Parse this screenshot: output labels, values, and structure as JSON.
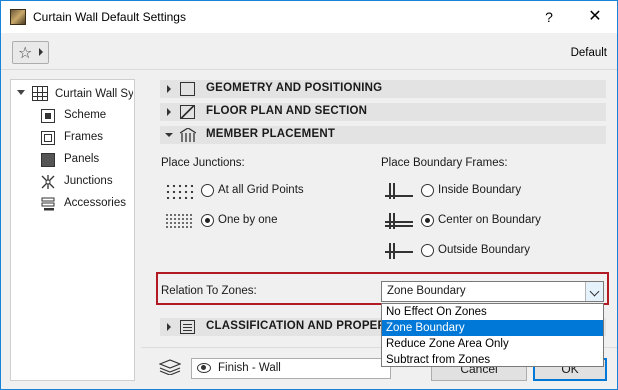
{
  "window": {
    "title": "Curtain Wall Default Settings",
    "help_label": "?",
    "close_label": "✕"
  },
  "toolbar": {
    "favorites_icon": "star-icon",
    "default_label": "Default"
  },
  "tree": {
    "root_label": "Curtain Wall Sy",
    "items": [
      {
        "label": "Scheme",
        "icon": "scheme-icon"
      },
      {
        "label": "Frames",
        "icon": "frames-icon"
      },
      {
        "label": "Panels",
        "icon": "panels-icon"
      },
      {
        "label": "Junctions",
        "icon": "junctions-icon"
      },
      {
        "label": "Accessories",
        "icon": "accessories-icon"
      }
    ]
  },
  "sections": {
    "geometry": "GEOMETRY AND POSITIONING",
    "floorplan": "FLOOR PLAN AND SECTION",
    "member": "MEMBER PLACEMENT",
    "classification": "CLASSIFICATION AND PROPERTIES"
  },
  "member_placement": {
    "junctions_label": "Place Junctions:",
    "junction_options": [
      {
        "label": "At all Grid Points",
        "checked": false
      },
      {
        "label": "One by one",
        "checked": true
      }
    ],
    "frames_label": "Place Boundary Frames:",
    "frame_options": [
      {
        "label": "Inside Boundary",
        "checked": false
      },
      {
        "label": "Center on Boundary",
        "checked": true
      },
      {
        "label": "Outside Boundary",
        "checked": false
      }
    ]
  },
  "zones": {
    "label": "Relation To Zones:",
    "value": "Zone Boundary",
    "options": [
      "No Effect On Zones",
      "Zone Boundary",
      "Reduce Zone Area Only",
      "Subtract from Zones"
    ],
    "selected_index": 1
  },
  "footer": {
    "layer_value": "Finish - Wall",
    "cancel_label": "Cancel",
    "ok_label": "OK"
  },
  "colors": {
    "highlight_border": "#b11a22",
    "selection": "#0078d7"
  }
}
